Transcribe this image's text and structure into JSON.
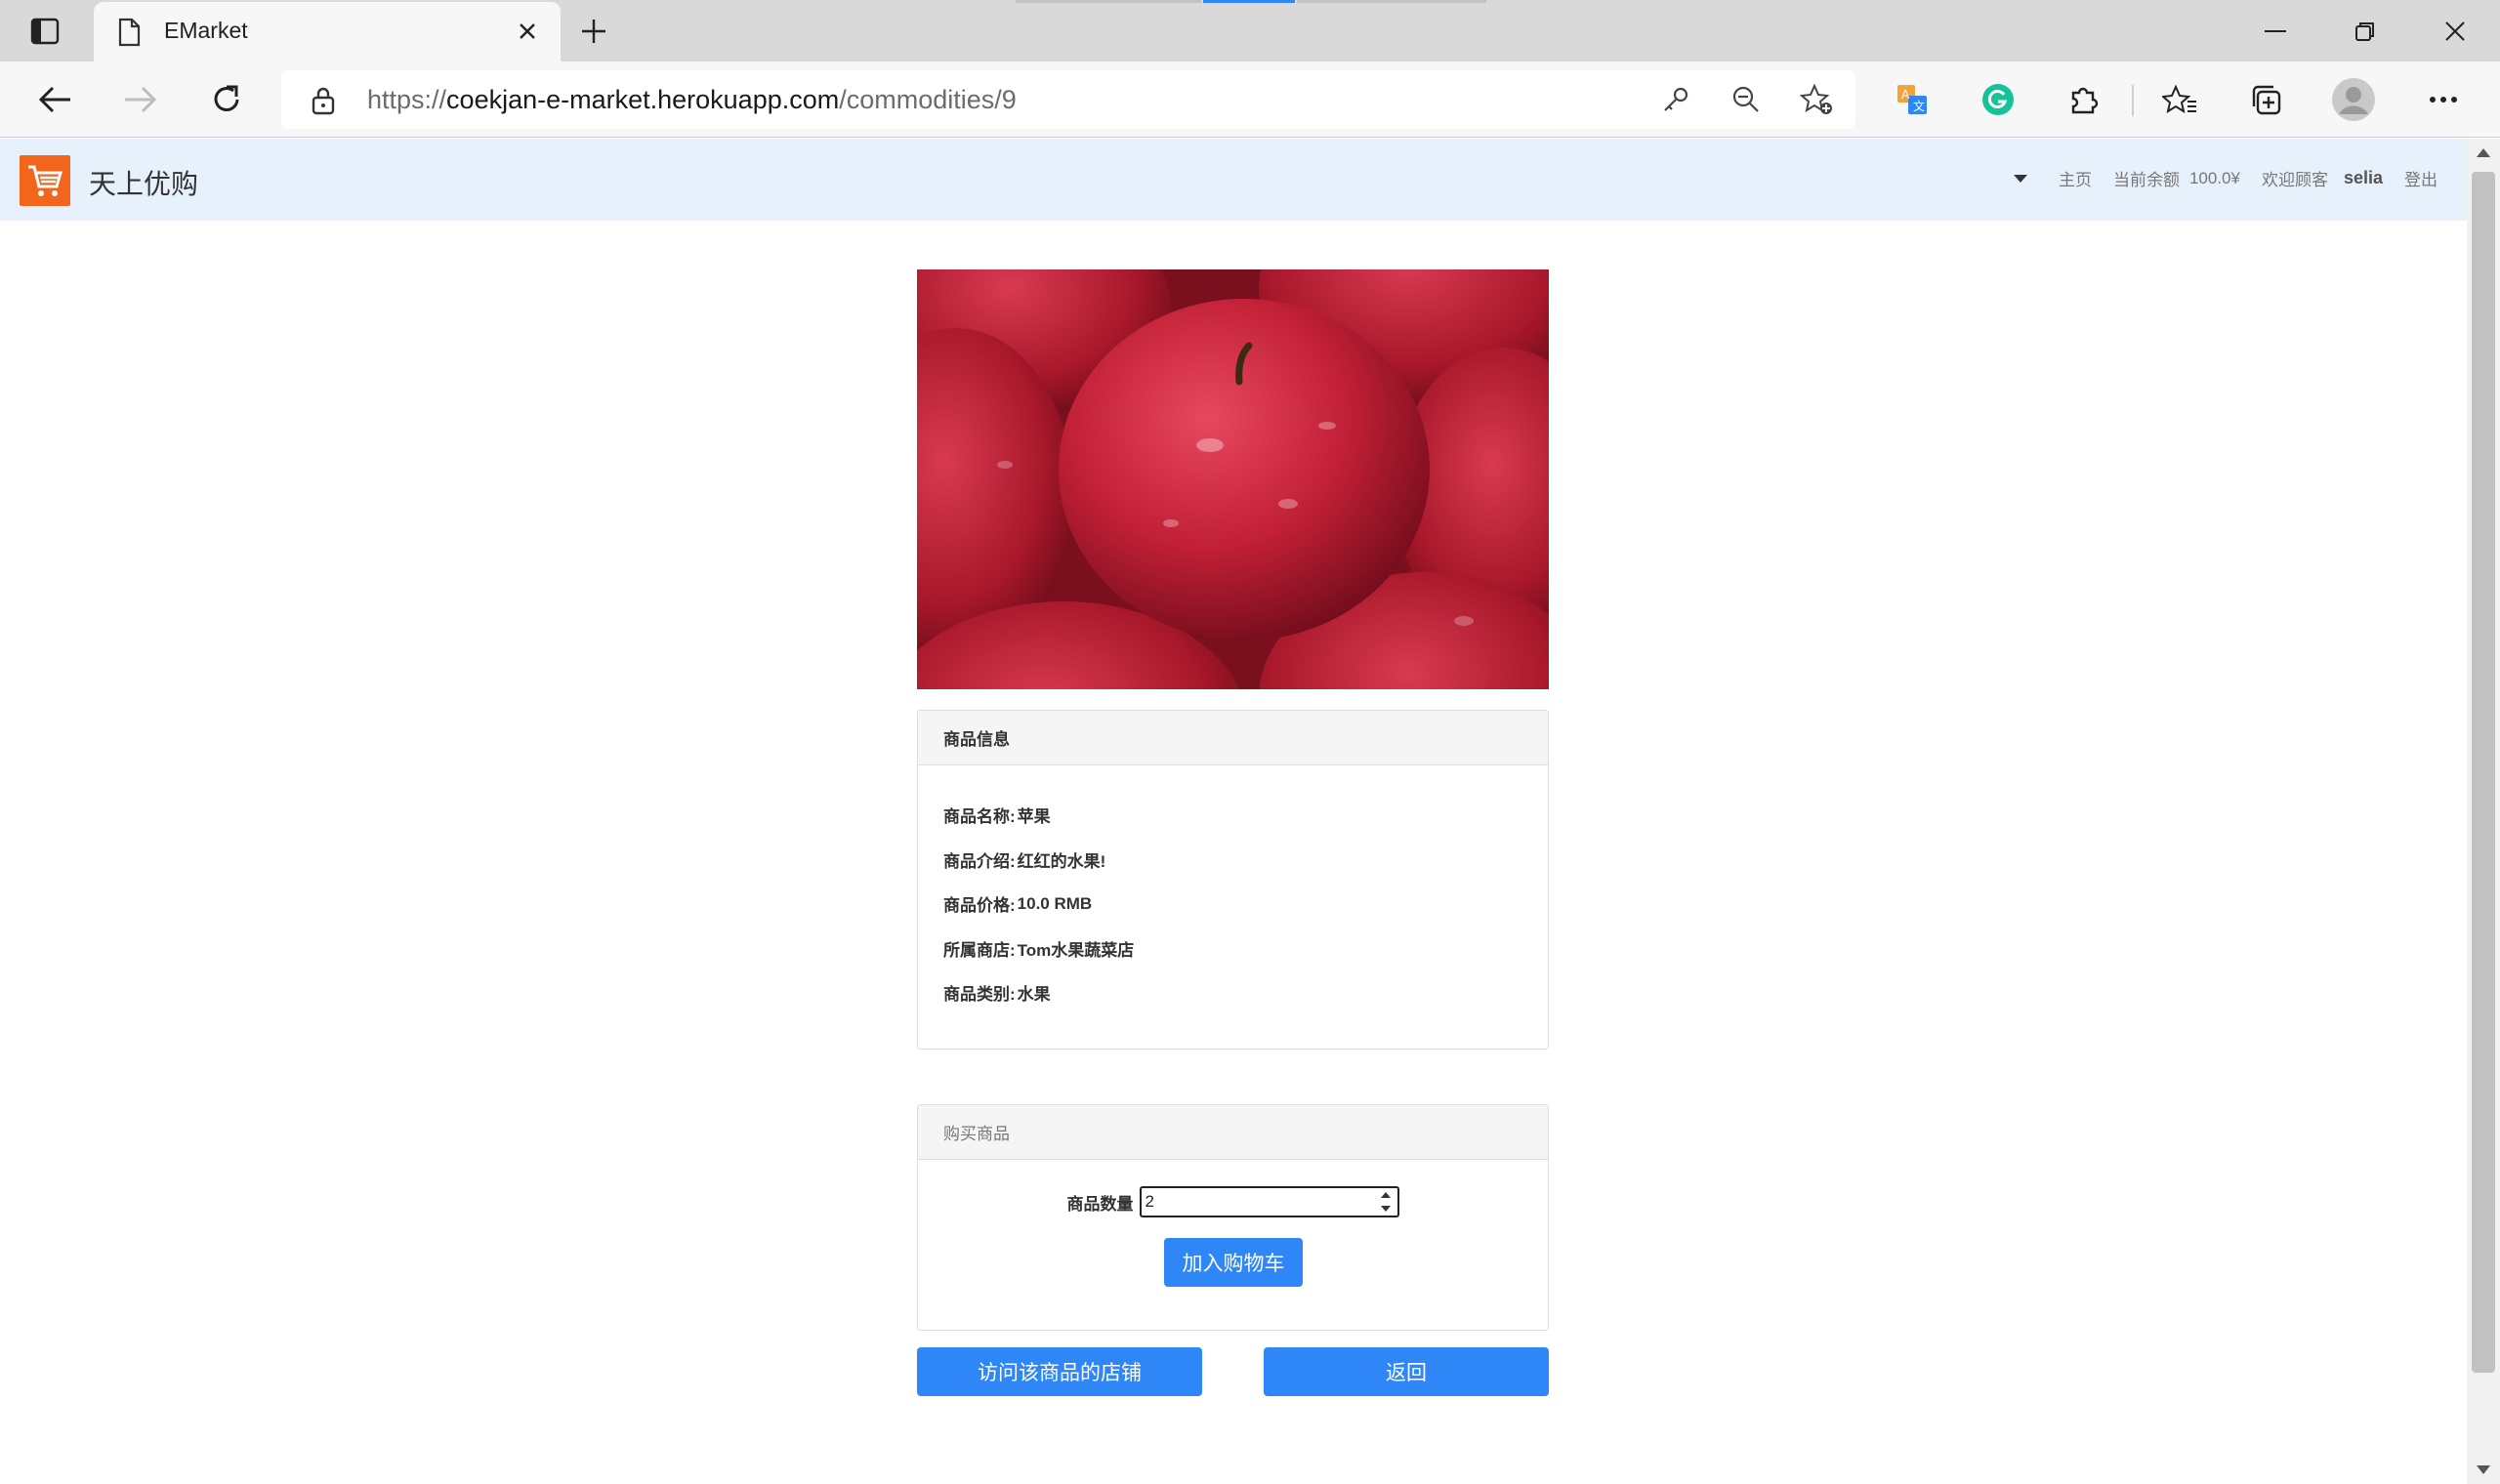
{
  "browser": {
    "tab_title": "EMarket",
    "url_host_prefix": "https://",
    "url_host": "coekjan-e-market.herokuapp.com",
    "url_path": "/commodities/9"
  },
  "navbar": {
    "brand": "天上优购",
    "home": "主页",
    "balance_label": "当前余额",
    "balance_value": "100.0¥",
    "welcome": "欢迎顾客",
    "username": "selia",
    "logout": "登出"
  },
  "info_panel": {
    "heading": "商品信息",
    "rows": [
      {
        "label": "商品名称:",
        "value": "苹果"
      },
      {
        "label": "商品介绍:",
        "value": "红红的水果!"
      },
      {
        "label": "商品价格:",
        "value": "10.0 RMB"
      },
      {
        "label": "所属商店:",
        "value": "Tom水果蔬菜店"
      },
      {
        "label": "商品类别:",
        "value": "水果"
      }
    ]
  },
  "buy_panel": {
    "heading": "购买商品",
    "qty_label": "商品数量",
    "qty_value": "2",
    "add_to_cart": "加入购物车"
  },
  "actions": {
    "visit_shop": "访问该商品的店铺",
    "back": "返回"
  },
  "colors": {
    "primary": "#2f86f6",
    "brand_logo": "#f2651b",
    "navbar_bg": "#e6f1fc"
  }
}
